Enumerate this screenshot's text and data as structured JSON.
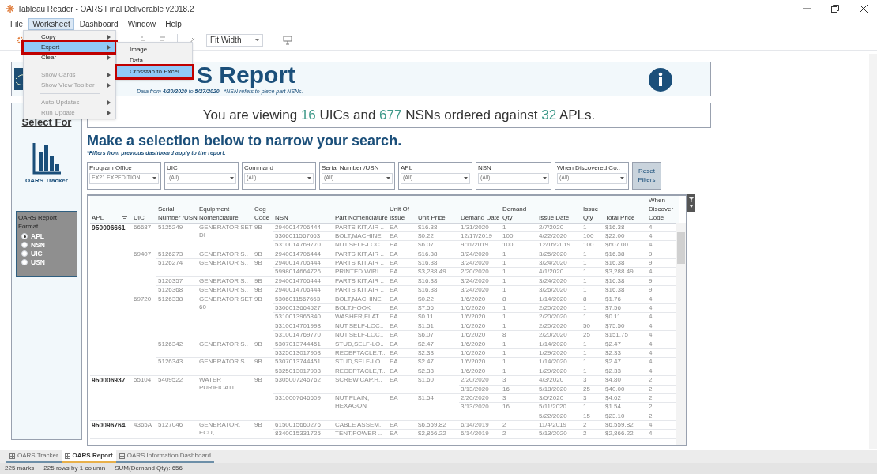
{
  "window": {
    "title": "Tableau Reader - OARS Final Deliverable v2018.2"
  },
  "menu_bar": [
    {
      "label": "File",
      "selected": false
    },
    {
      "label": "Worksheet",
      "selected": true
    },
    {
      "label": "Dashboard",
      "selected": false
    },
    {
      "label": "Window",
      "selected": false
    },
    {
      "label": "Help",
      "selected": false
    }
  ],
  "open_menu": {
    "items": [
      {
        "kind": "item",
        "label": "Copy",
        "disabled": false,
        "selected": false,
        "annotated": false
      },
      {
        "kind": "item",
        "label": "Export",
        "disabled": false,
        "selected": true,
        "annotated": true
      },
      {
        "kind": "item",
        "label": "Clear",
        "disabled": false,
        "selected": false,
        "annotated": false
      },
      {
        "kind": "separator"
      },
      {
        "kind": "item",
        "label": "Show Cards",
        "disabled": true,
        "selected": false,
        "annotated": false
      },
      {
        "kind": "item",
        "label": "Show View Toolbar",
        "disabled": true,
        "selected": false,
        "annotated": false
      },
      {
        "kind": "separator"
      },
      {
        "kind": "item",
        "label": "Auto Updates",
        "disabled": true,
        "selected": false,
        "annotated": false
      },
      {
        "kind": "item",
        "label": "Run Update",
        "disabled": true,
        "selected": false,
        "annotated": false
      }
    ],
    "submenu": [
      {
        "label": "Image...",
        "selected": false,
        "annotated": false
      },
      {
        "label": "Data...",
        "selected": false,
        "annotated": false
      },
      {
        "label": "Crosstab to Excel",
        "selected": true,
        "annotated": true
      }
    ]
  },
  "toolbar": {
    "fit_dropdown": "Fit Width"
  },
  "header": {
    "title": "S Report",
    "subtitle": "Data from **4/20/2020** to **5/27/2020**   *NSN refers to piece part NSNs."
  },
  "sidebar": {
    "link": "Select For",
    "tracker_label": "OARS Tracker",
    "format_title": "OARS Report Format",
    "options": [
      {
        "label": "APL",
        "selected": true
      },
      {
        "label": "NSN",
        "selected": false
      },
      {
        "label": "UIC",
        "selected": false
      },
      {
        "label": "USN",
        "selected": false
      }
    ]
  },
  "banner": [
    {
      "text": "You are viewing ",
      "kind": "plain"
    },
    {
      "text": "16",
      "kind": "number"
    },
    {
      "text": " UICs and ",
      "kind": "plain"
    },
    {
      "text": "677",
      "kind": "number"
    },
    {
      "text": " NSNs ordered against ",
      "kind": "plain"
    },
    {
      "text": "32",
      "kind": "number"
    },
    {
      "text": " APLs.",
      "kind": "plain"
    }
  ],
  "heading": "Make a selection below to narrow your search.",
  "note": "*Filters from previous dashboard apply to the report.",
  "filters": [
    {
      "label": "Program Office",
      "value": "EX21 EXPEDITION..."
    },
    {
      "label": "UIC",
      "value": "(All)"
    },
    {
      "label": "Command",
      "value": "(All)"
    },
    {
      "label": "Serial Number /USN",
      "value": "(All)"
    },
    {
      "label": "APL",
      "value": "(All)"
    },
    {
      "label": "NSN",
      "value": "(All)"
    },
    {
      "label": "When Discovered Co..",
      "value": "(All)"
    }
  ],
  "reset_button": "Reset Filters",
  "table": {
    "columns": [
      "APL",
      "UIC",
      "Serial Number /USN",
      "Equipment Nomenclature",
      "Cog Code",
      "NSN",
      "Part Nomenclature",
      "Unit Of Issue",
      "Unit Price",
      "Demand Date",
      "Demand Qty",
      "Issue Date",
      "Issue Qty",
      "Total Price",
      "When Discover Code"
    ],
    "rows": [
      [
        {
          "text": "950006661",
          "rowspan": 17
        },
        {
          "text": "66687",
          "rowspan": 3
        },
        {
          "text": "5125249",
          "rowspan": 3
        },
        {
          "text": "GENERATOR SET DI",
          "rowspan": 3
        },
        {
          "text": "9B",
          "rowspan": 3
        },
        "2940014706444",
        "PARTS KIT,AIR ..",
        "EA",
        "$16.38",
        "1/31/2020",
        "1",
        "2/7/2020",
        "1",
        "$16.38",
        "4"
      ],
      [
        "5306011567663",
        "BOLT,MACHINE",
        "EA",
        "$0.22",
        "12/17/2019",
        "100",
        "4/22/2020",
        "100",
        "$22.00",
        "4"
      ],
      [
        "5310014769770",
        "NUT,SELF-LOC..",
        "EA",
        "$6.07",
        "9/11/2019",
        "100",
        "12/16/2019",
        "100",
        "$607.00",
        "4"
      ],
      [
        {
          "text": "69407",
          "rowspan": 5
        },
        "5126273",
        "GENERATOR S..",
        "9B",
        "2940014706444",
        "PARTS KIT,AIR ..",
        "EA",
        "$16.38",
        "3/24/2020",
        "1",
        "3/25/2020",
        "1",
        "$16.38",
        "9"
      ],
      [
        {
          "text": "5126274",
          "rowspan": 2
        },
        {
          "text": "GENERATOR S..",
          "rowspan": 2
        },
        {
          "text": "9B",
          "rowspan": 2
        },
        "2940014706444",
        "PARTS KIT,AIR ..",
        "EA",
        "$16.38",
        "3/24/2020",
        "1",
        "3/24/2020",
        "1",
        "$16.38",
        "9"
      ],
      [
        "5998014664726",
        "PRINTED WIRI..",
        "EA",
        "$3,288.49",
        "2/20/2020",
        "1",
        "4/1/2020",
        "1",
        "$3,288.49",
        "4"
      ],
      [
        "5126357",
        "GENERATOR S..",
        "9B",
        "2940014706444",
        "PARTS KIT,AIR ..",
        "EA",
        "$16.38",
        "3/24/2020",
        "1",
        "3/24/2020",
        "1",
        "$16.38",
        "9"
      ],
      [
        "5126368",
        "GENERATOR S..",
        "9B",
        "2940014706444",
        "PARTS KIT,AIR ..",
        "EA",
        "$16.38",
        "3/24/2020",
        "1",
        "3/26/2020",
        "1",
        "$16.38",
        "9"
      ],
      [
        {
          "text": "69720",
          "rowspan": 9
        },
        {
          "text": "5126338",
          "rowspan": 5
        },
        {
          "text": "GENERATOR SET 60",
          "rowspan": 5
        },
        {
          "text": "9B",
          "rowspan": 5
        },
        "5306011567663",
        "BOLT,MACHINE",
        "EA",
        "$0.22",
        "1/6/2020",
        "8",
        "1/14/2020",
        "8",
        "$1.76",
        "4"
      ],
      [
        "5306013664527",
        "BOLT,HOOK",
        "EA",
        "$7.56",
        "1/6/2020",
        "1",
        "2/20/2020",
        "1",
        "$7.56",
        "4"
      ],
      [
        "5310013965840",
        "WASHER,FLAT",
        "EA",
        "$0.11",
        "1/6/2020",
        "1",
        "2/20/2020",
        "1",
        "$0.11",
        "4"
      ],
      [
        "5310014701998",
        "NUT,SELF-LOC..",
        "EA",
        "$1.51",
        "1/6/2020",
        "1",
        "2/20/2020",
        "50",
        "$75.50",
        "4"
      ],
      [
        "5310014769770",
        "NUT,SELF-LOC..",
        "EA",
        "$6.07",
        "1/6/2020",
        "8",
        "2/20/2020",
        "25",
        "$151.75",
        "4"
      ],
      [
        {
          "text": "5126342",
          "rowspan": 2
        },
        {
          "text": "GENERATOR S..",
          "rowspan": 2
        },
        {
          "text": "9B",
          "rowspan": 2
        },
        "5307013744451",
        "STUD,SELF-LO..",
        "EA",
        "$2.47",
        "1/6/2020",
        "1",
        "1/14/2020",
        "1",
        "$2.47",
        "4"
      ],
      [
        "5325013017903",
        "RECEPTACLE,T..",
        "EA",
        "$2.33",
        "1/6/2020",
        "1",
        "1/29/2020",
        "1",
        "$2.33",
        "4"
      ],
      [
        {
          "text": "5126343",
          "rowspan": 2
        },
        {
          "text": "GENERATOR S..",
          "rowspan": 2
        },
        {
          "text": "9B",
          "rowspan": 2
        },
        "5307013744451",
        "STUD,SELF-LO..",
        "EA",
        "$2.47",
        "1/6/2020",
        "1",
        "1/14/2020",
        "1",
        "$2.47",
        "4"
      ],
      [
        "5325013017903",
        "RECEPTACLE,T..",
        "EA",
        "$2.33",
        "1/6/2020",
        "1",
        "1/29/2020",
        "1",
        "$2.33",
        "4"
      ],
      [
        {
          "text": "950006937",
          "rowspan": 5
        },
        {
          "text": "55104",
          "rowspan": 5
        },
        {
          "text": "5409522",
          "rowspan": 5
        },
        {
          "text": "WATER PURIFICATI",
          "rowspan": 5
        },
        {
          "text": "9B",
          "rowspan": 5
        },
        {
          "text": "5305007246762",
          "rowspan": 2
        },
        {
          "text": "SCREW,CAP,H..",
          "rowspan": 2
        },
        {
          "text": "EA",
          "rowspan": 2
        },
        {
          "text": "$1.60",
          "rowspan": 2
        },
        "2/20/2020",
        "3",
        "4/3/2020",
        "3",
        "$4.80",
        "2"
      ],
      [
        "3/13/2020",
        "16",
        "5/18/2020",
        "25",
        "$40.00",
        "2"
      ],
      [
        {
          "text": "5310007646609",
          "rowspan": 3
        },
        {
          "text": "NUT,PLAIN, HEXAGON",
          "rowspan": 3
        },
        {
          "text": "EA",
          "rowspan": 3
        },
        {
          "text": "$1.54",
          "rowspan": 3
        },
        "2/20/2020",
        "3",
        "3/5/2020",
        "3",
        "$4.62",
        "2"
      ],
      [
        {
          "text": "3/13/2020",
          "rowspan": 2
        },
        {
          "text": "16",
          "rowspan": 2
        },
        "5/11/2020",
        "1",
        "$1.54",
        "2"
      ],
      [
        "5/22/2020",
        "15",
        "$23.10",
        "2"
      ],
      [
        {
          "text": "950096764",
          "rowspan": 2
        },
        {
          "text": "4365A",
          "rowspan": 2
        },
        {
          "text": "5127046",
          "rowspan": 2
        },
        {
          "text": "GENERATOR, ECU,",
          "rowspan": 2
        },
        {
          "text": "9B",
          "rowspan": 2
        },
        "6150015660276",
        "CABLE ASSEM..",
        "EA",
        "$6,559.82",
        "6/14/2019",
        "2",
        "11/4/2019",
        "2",
        "$6,559.82",
        "4"
      ],
      [
        "8340015331725",
        "TENT,POWER ..",
        "EA",
        "$2,866.22",
        "6/14/2019",
        "2",
        "5/13/2020",
        "2",
        "$2,866.22",
        "4"
      ]
    ]
  },
  "sheet_tabs": [
    {
      "label": "OARS Tracker",
      "selected": false
    },
    {
      "label": "OARS Report",
      "selected": true
    },
    {
      "label": "OARS Information Dashboard",
      "selected": false
    }
  ],
  "status_bar": [
    "225 marks",
    "225 rows by 1 column",
    "SUM(Demand Qty): 656"
  ]
}
